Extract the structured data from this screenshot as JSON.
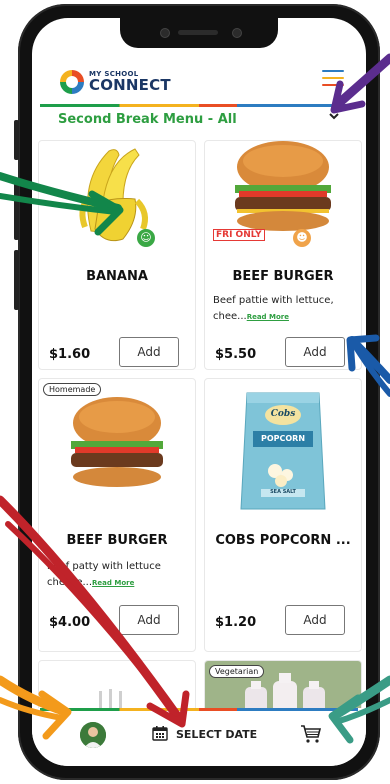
{
  "header": {
    "logo_small": "MY SCHOOL",
    "logo_big": "CONNECT"
  },
  "menu": {
    "title": "Second Break Menu - All",
    "chevron": "⌄"
  },
  "items": [
    {
      "name": "BANANA",
      "price": "$1.60",
      "add_label": "Add",
      "icon": "banana-image",
      "health": "green"
    },
    {
      "name": "BEEF BURGER",
      "description": "Beef pattie with lettuce, chee...",
      "read_more": "Read More",
      "price": "$5.50",
      "add_label": "Add",
      "badge": "FRI ONLY",
      "health": "orange",
      "icon": "burger-image"
    },
    {
      "name": "BEEF BURGER",
      "description": "beef patty with lettuce cheese...",
      "read_more": "Read More",
      "price": "$4.00",
      "add_label": "Add",
      "tag": "Homemade",
      "icon": "burger-image"
    },
    {
      "name": "COBS POPCORN ...",
      "price": "$1.20",
      "add_label": "Add",
      "icon": "popcorn-bag-image",
      "bag_brand": "Cobs",
      "bag_label": "POPCORN",
      "bag_sub": "SEA SALT"
    },
    {
      "icon": "cutlery-image"
    },
    {
      "tag": "Vegetarian",
      "icon": "milk-bottles-image"
    }
  ],
  "bottom": {
    "select_date": "SELECT DATE",
    "calendar_icon": "calendar-icon",
    "cart_icon": "cart-icon",
    "avatar_icon": "avatar"
  },
  "colors": {
    "brand_green": "#2e9e41",
    "brand_navy": "#1b3765",
    "arrow_purple": "#5b2d8e",
    "arrow_green": "#12864a",
    "arrow_blue": "#1a5aa8",
    "arrow_red": "#c0232a",
    "arrow_orange": "#f39a1b",
    "arrow_teal": "#3a9c86"
  }
}
